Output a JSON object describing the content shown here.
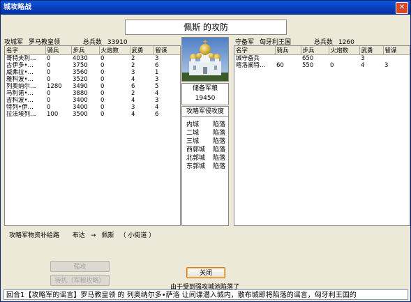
{
  "window": {
    "title": "城攻略战"
  },
  "battle_title": "佩斯 的攻防",
  "attacker": {
    "label": "攻城军",
    "commander": "罗马教皇领",
    "total_label": "总兵数",
    "total": "33910",
    "columns": [
      "名字",
      "骑兵",
      "步兵",
      "火炮数",
      "武勇",
      "智谋"
    ],
    "rows": [
      [
        "哥特夫利…",
        "0",
        "4030",
        "0",
        "2",
        "3"
      ],
      [
        "古伊多•…",
        "0",
        "3750",
        "0",
        "2",
        "6"
      ],
      [
        "威弗拉•…",
        "0",
        "3560",
        "0",
        "3",
        "1"
      ],
      [
        "雅科波•…",
        "0",
        "3520",
        "0",
        "4",
        "3"
      ],
      [
        "列奥纳尔…",
        "1280",
        "3490",
        "0",
        "6",
        "5"
      ],
      [
        "马利诺•…",
        "0",
        "3880",
        "0",
        "2",
        "4"
      ],
      [
        "吉科波•…",
        "0",
        "3400",
        "0",
        "4",
        "3"
      ],
      [
        "特列•伊…",
        "0",
        "3400",
        "0",
        "3",
        "4"
      ],
      [
        "拉法埃列…",
        "100",
        "3500",
        "0",
        "4",
        "6"
      ]
    ]
  },
  "defender": {
    "label": "守备军",
    "commander": "匈牙利王国",
    "total_label": "总兵数",
    "total": "1260",
    "columns": [
      "名字",
      "骑兵",
      "步兵",
      "火炮数",
      "武勇",
      "智谋"
    ],
    "rows": [
      [
        "城守备兵",
        "",
        "650",
        "",
        "3",
        ""
      ],
      [
        "喀洛阑特…",
        "60",
        "550",
        "0",
        "4",
        "3"
      ]
    ]
  },
  "supply": {
    "label": "储备军粮",
    "value": "19450"
  },
  "progress": {
    "label": "攻略军侵攻度",
    "items": [
      {
        "name": "内城",
        "status": "陷落"
      },
      {
        "name": "二城",
        "status": "陷落"
      },
      {
        "name": "三城",
        "status": "陷落"
      },
      {
        "name": "西郭城",
        "status": "陷落"
      },
      {
        "name": "北郭城",
        "status": "陷落"
      },
      {
        "name": "东郭城",
        "status": "陷落"
      }
    ]
  },
  "route": {
    "label": "攻略军物资补给路",
    "from": "布达",
    "arrow": "→",
    "to": "佩斯",
    "via": "（ 小街道 ）"
  },
  "buttons": {
    "assault": "强攻",
    "wait": "待机（军粮攻略）",
    "close": "关闭"
  },
  "status_text": "由于受到强攻城池陷落了",
  "log_text": "回合1【攻略军的谣言】罗马教皇领 的 列奥纳尔多•萨洛 让间谍潜入城内，散布城即将陷落的谣言，匈牙利王国的"
}
